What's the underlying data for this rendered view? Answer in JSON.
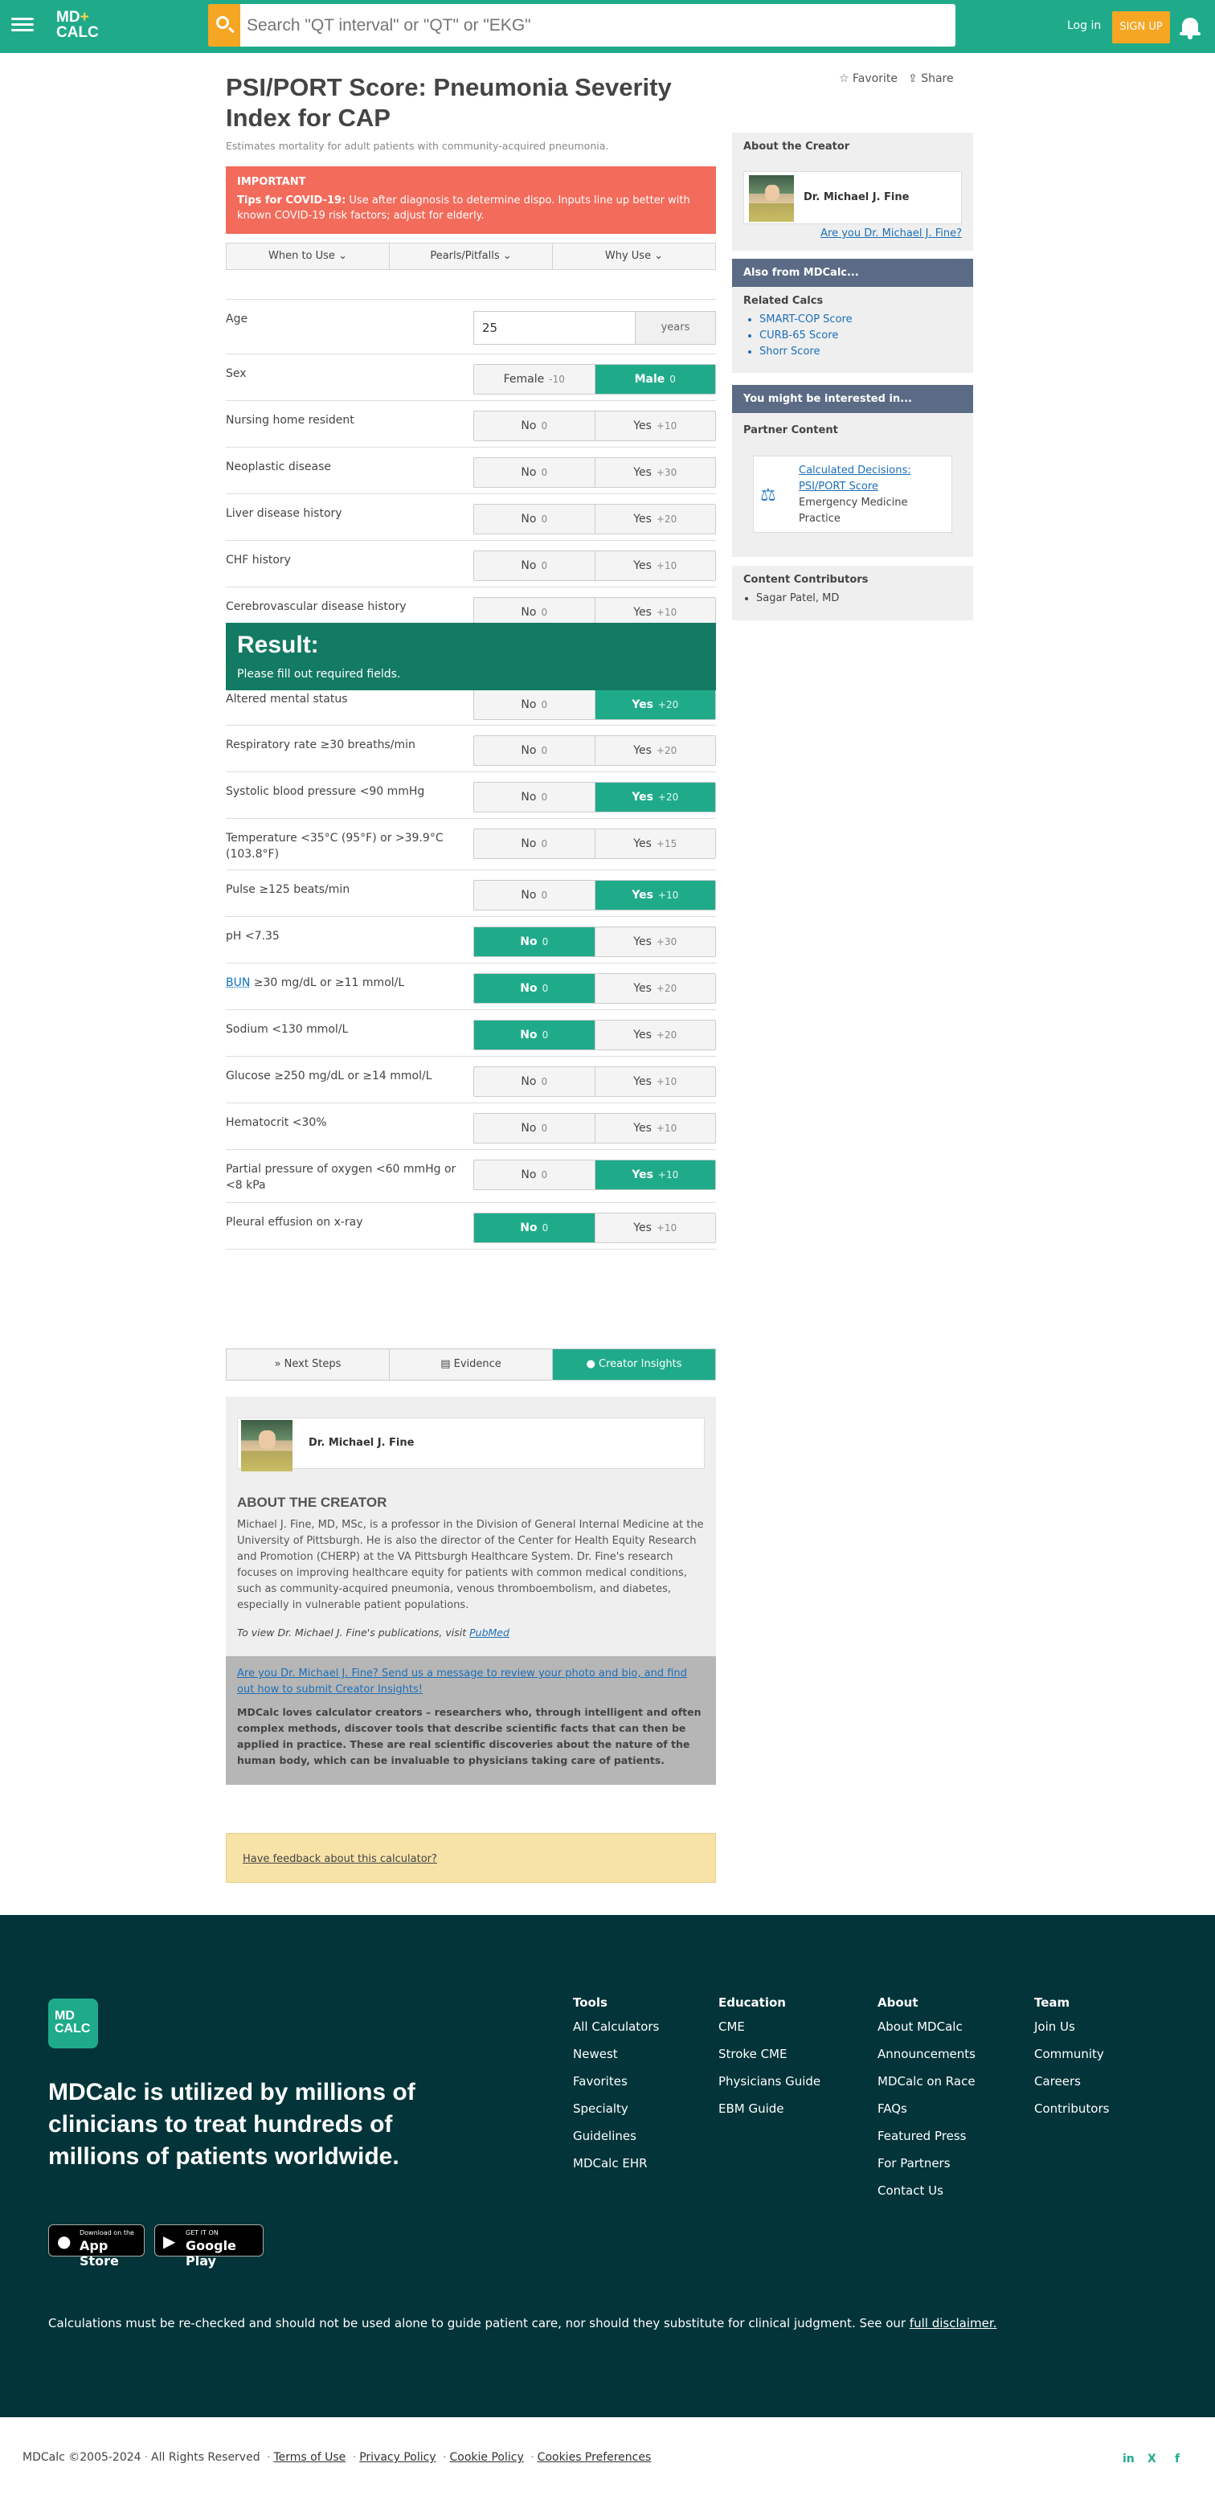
{
  "header": {
    "logo_line1": "MD",
    "logo_plus": "+",
    "logo_line2": "CALC",
    "search_placeholder": "Search \"QT interval\" or \"QT\" or \"EKG\"",
    "login": "Log in",
    "signup": "SIGN UP"
  },
  "calc": {
    "title": "PSI/PORT Score: Pneumonia Severity Index for CAP",
    "subtitle": "Estimates mortality for adult patients with community-acquired pneumonia.",
    "favorite": "Favorite",
    "share": "Share",
    "important_heading": "IMPORTANT",
    "important_lead": "Tips for COVID-19:",
    "important_text": "Use after diagnosis to determine dispo. Inputs line up better with known COVID-19 risk factors; adjust for elderly.",
    "tabs": [
      "When to Use",
      "Pearls/Pitfalls",
      "Why Use"
    ]
  },
  "age": {
    "label": "Age",
    "value": "25",
    "unit": "years"
  },
  "rows": [
    {
      "label": "Sex",
      "options": [
        {
          "text": "Female",
          "pts": "-10"
        },
        {
          "text": "Male",
          "pts": "0"
        }
      ],
      "selected": 1
    },
    {
      "label": "Nursing home resident",
      "options": [
        {
          "text": "No",
          "pts": "0"
        },
        {
          "text": "Yes",
          "pts": "+10"
        }
      ],
      "selected": -1
    },
    {
      "label": "Neoplastic disease",
      "options": [
        {
          "text": "No",
          "pts": "0"
        },
        {
          "text": "Yes",
          "pts": "+30"
        }
      ],
      "selected": -1
    },
    {
      "label": "Liver disease history",
      "options": [
        {
          "text": "No",
          "pts": "0"
        },
        {
          "text": "Yes",
          "pts": "+20"
        }
      ],
      "selected": -1
    },
    {
      "label": "CHF history",
      "options": [
        {
          "text": "No",
          "pts": "0"
        },
        {
          "text": "Yes",
          "pts": "+10"
        }
      ],
      "selected": -1
    },
    {
      "label": "Cerebrovascular disease history",
      "options": [
        {
          "text": "No",
          "pts": "0"
        },
        {
          "text": "Yes",
          "pts": "+10"
        }
      ],
      "selected": -1
    },
    {
      "label": "Altered mental status",
      "options": [
        {
          "text": "No",
          "pts": "0"
        },
        {
          "text": "Yes",
          "pts": "+20"
        }
      ],
      "selected": 1
    },
    {
      "label": "Respiratory rate ≥30 breaths/min",
      "options": [
        {
          "text": "No",
          "pts": "0"
        },
        {
          "text": "Yes",
          "pts": "+20"
        }
      ],
      "selected": -1
    },
    {
      "label": "Systolic blood pressure <90 mmHg",
      "options": [
        {
          "text": "No",
          "pts": "0"
        },
        {
          "text": "Yes",
          "pts": "+20"
        }
      ],
      "selected": 1
    },
    {
      "label": "Temperature <35°C (95°F) or >39.9°C (103.8°F)",
      "options": [
        {
          "text": "No",
          "pts": "0"
        },
        {
          "text": "Yes",
          "pts": "+15"
        }
      ],
      "selected": -1
    },
    {
      "label": "Pulse ≥125 beats/min",
      "options": [
        {
          "text": "No",
          "pts": "0"
        },
        {
          "text": "Yes",
          "pts": "+10"
        }
      ],
      "selected": 1
    },
    {
      "label": "pH <7.35",
      "options": [
        {
          "text": "No",
          "pts": "0"
        },
        {
          "text": "Yes",
          "pts": "+30"
        }
      ],
      "selected": 0
    },
    {
      "label_abbr": "BUN",
      "label": " ≥30 mg/dL or ≥11 mmol/L",
      "options": [
        {
          "text": "No",
          "pts": "0"
        },
        {
          "text": "Yes",
          "pts": "+20"
        }
      ],
      "selected": 0
    },
    {
      "label": "Sodium <130 mmol/L",
      "options": [
        {
          "text": "No",
          "pts": "0"
        },
        {
          "text": "Yes",
          "pts": "+20"
        }
      ],
      "selected": 0
    },
    {
      "label": "Glucose ≥250 mg/dL or ≥14 mmol/L",
      "options": [
        {
          "text": "No",
          "pts": "0"
        },
        {
          "text": "Yes",
          "pts": "+10"
        }
      ],
      "selected": -1
    },
    {
      "label": "Hematocrit <30%",
      "options": [
        {
          "text": "No",
          "pts": "0"
        },
        {
          "text": "Yes",
          "pts": "+10"
        }
      ],
      "selected": -1
    },
    {
      "label": "Partial pressure of oxygen <60 mmHg or <8 kPa",
      "options": [
        {
          "text": "No",
          "pts": "0"
        },
        {
          "text": "Yes",
          "pts": "+10"
        }
      ],
      "selected": 1
    },
    {
      "label": "Pleural effusion on x-ray",
      "options": [
        {
          "text": "No",
          "pts": "0"
        },
        {
          "text": "Yes",
          "pts": "+10"
        }
      ],
      "selected": 0
    }
  ],
  "result": {
    "title": "Result:",
    "message": "Please fill out required fields."
  },
  "sidebar": {
    "about_creator_heading": "About the Creator",
    "creator_name": "Dr. Michael J. Fine",
    "creator_link": "Are you Dr. Michael J. Fine?",
    "also_heading": "Also from MDCalc...",
    "related_heading": "Related Calcs",
    "related": [
      "SMART-COP Score",
      "CURB-65 Score",
      "Shorr Score"
    ],
    "interested_heading": "You might be interested in...",
    "partner_heading": "Partner Content",
    "partner_link": "Calculated Decisions: PSI/PORT Score",
    "partner_org": "Emergency Medicine Practice",
    "contributors_heading": "Content Contributors",
    "contributors": [
      "Sagar Patel, MD"
    ]
  },
  "bottom_tabs": [
    "Next Steps",
    "Evidence",
    "Creator Insights"
  ],
  "insights": {
    "name": "Dr. Michael J. Fine",
    "about_heading": "ABOUT THE CREATOR",
    "about_text": "Michael J. Fine, MD, MSc, is a professor in the Division of General Internal Medicine at the University of Pittsburgh. He is also the director of the Center for Health Equity Research and Promotion (CHERP) at the VA Pittsburgh Healthcare System. Dr. Fine's research focuses on improving healthcare equity for patients with common medical conditions, such as community-acquired pneumonia, venous thromboembolism, and diabetes, especially in vulnerable patient populations.",
    "pubmed_prefix": "To view Dr. Michael J. Fine's publications, visit ",
    "pubmed_link": "PubMed",
    "submit_link": "Are you Dr. Michael J. Fine? Send us a message to review your photo and bio, and find out how to submit Creator Insights!",
    "creators_text": "MDCalc loves calculator creators – researchers who, through intelligent and often complex methods, discover tools that describe scientific facts that can then be applied in practice. These are real scientific discoveries about the nature of the human body, which can be invaluable to physicians taking care of patients."
  },
  "feedback": "Have feedback about this calculator?",
  "footer": {
    "logo_line1": "MD",
    "logo_line2": "CALC",
    "tagline": "MDCalc is utilized by millions of clinicians to treat hundreds of millions of patients worldwide.",
    "appstore_small": "Download on the",
    "appstore_big": "App Store",
    "gplay_small": "GET IT ON",
    "gplay_big": "Google Play",
    "columns": [
      {
        "heading": "Tools",
        "items": [
          "All Calculators",
          "Newest",
          "Favorites",
          "Specialty",
          "Guidelines",
          "MDCalc EHR"
        ]
      },
      {
        "heading": "Education",
        "items": [
          "CME",
          "Stroke CME",
          "Physicians Guide",
          "EBM Guide"
        ]
      },
      {
        "heading": "About",
        "items": [
          "About MDCalc",
          "Announcements",
          "MDCalc on Race",
          "FAQs",
          "Featured Press",
          "For Partners",
          "Contact Us"
        ]
      },
      {
        "heading": "Team",
        "items": [
          "Join Us",
          "Community",
          "Careers",
          "Contributors"
        ]
      }
    ],
    "disclaimer": "Calculations must be re-checked and should not be used alone to guide patient care, nor should they substitute for clinical judgment. See our ",
    "disclaimer_link": "full disclaimer.",
    "copyright": "MDCalc ©2005-2024",
    "rights": "All Rights Reserved",
    "legal": [
      "Terms of Use",
      "Privacy Policy",
      "Cookie Policy",
      "Cookies Preferences"
    ],
    "social": [
      "in",
      "X",
      "f"
    ]
  }
}
